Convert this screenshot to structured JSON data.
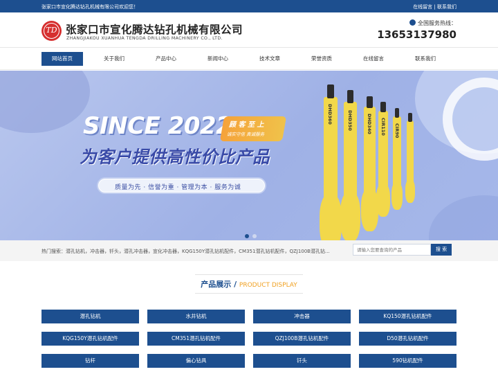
{
  "topbar": {
    "welcome": "张家口市宣化腾达钻孔机械有限公司欢迎您！",
    "links": [
      "在线留言",
      "联系我们"
    ],
    "separator": " | "
  },
  "header": {
    "logo_text": "TD",
    "company_name": "张家口市宣化腾达钻孔机械有限公司",
    "company_en": "ZHANGJIAKOU XUANHUA TENGDA DRILLING MACHINERY CO., LTD.",
    "hotline_label": "全国服务热线：",
    "hotline_number": "13653137980"
  },
  "nav": {
    "items": [
      "网站首页",
      "关于我们",
      "产品中心",
      "新闻中心",
      "技术文章",
      "荣誉资质",
      "在线留言",
      "联系我们"
    ],
    "active_index": 0
  },
  "banner": {
    "since": "SINCE 2022",
    "badge_title": "顾 客 至 上",
    "badge_sub": "诚实守信 真诚服务",
    "slogan": "为客户提供高性价比产品",
    "pill": "质量为先 · 信誉为重 · 管理为本 · 服务为诚",
    "products": [
      "DHD360",
      "DHD350",
      "DHD340",
      "CIR110",
      "CIR90"
    ],
    "slide_count": 2,
    "active_slide": 0
  },
  "search": {
    "hot_label": "热门搜索：",
    "hot_terms": "潜孔钻机，冲击器，钎头，潜孔冲击器，宣化冲击器，KQG150Y潜孔钻机配件，CM351潜孔钻机配件，QZJ100B潜孔钻...",
    "placeholder": "请输入您要查询的产品",
    "button": "搜 索"
  },
  "section": {
    "title_cn": "产品展示",
    "slash": " / ",
    "title_en": "PRODUCT DISPLAY"
  },
  "categories": [
    "潜孔钻机",
    "水井钻机",
    "冲击器",
    "KQ150潜孔钻机配件",
    "KQG150Y潜孔钻机配件",
    "CM351潜孔钻机配件",
    "QZJ100B潜孔钻机配件",
    "D50潜孔钻机配件",
    "钻杆",
    "偏心钻具",
    "钎头",
    "590钻机配件"
  ],
  "colors": {
    "primary": "#1d4f8f",
    "accent": "#f0a020",
    "logo_red": "#d62f2f",
    "bit_yellow": "#f2d84a"
  }
}
